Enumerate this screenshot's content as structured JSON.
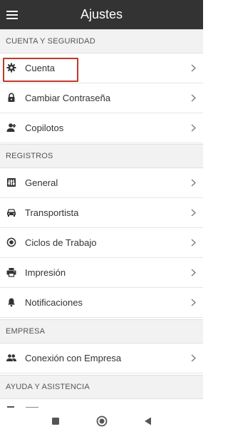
{
  "header": {
    "title": "Ajustes",
    "menu_icon": "menu-icon"
  },
  "sections": [
    {
      "label": "CUENTA Y SEGURIDAD"
    },
    {
      "label": "REGISTROS"
    },
    {
      "label": "EMPRESA"
    },
    {
      "label": "AYUDA Y ASISTENCIA"
    }
  ],
  "items": [
    {
      "label": "Cuenta",
      "icon": "gear-icon"
    },
    {
      "label": "Cambiar Contraseña",
      "icon": "lock-icon"
    },
    {
      "label": "Copilotos",
      "icon": "person-icon"
    },
    {
      "label": "General",
      "icon": "sliders-icon"
    },
    {
      "label": "Transportista",
      "icon": "truck-icon"
    },
    {
      "label": "Ciclos de Trabajo",
      "icon": "radio-icon"
    },
    {
      "label": "Impresión",
      "icon": "printer-icon"
    },
    {
      "label": "Notificaciones",
      "icon": "bell-icon"
    },
    {
      "label": "Conexión con Empresa",
      "icon": "people-icon"
    }
  ],
  "colors": {
    "header_bg": "#333333",
    "section_bg": "#f2f2f2",
    "highlight": "#c0392b"
  },
  "navbar": {
    "buttons": [
      "square-icon",
      "circle-icon",
      "back-triangle-icon"
    ]
  }
}
